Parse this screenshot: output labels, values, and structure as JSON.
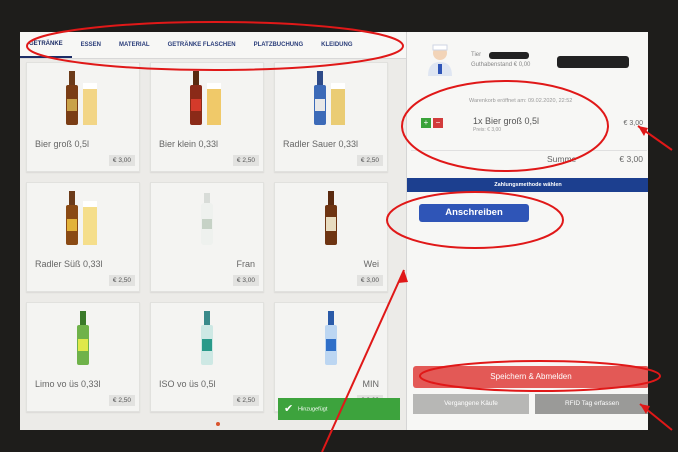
{
  "tabs": [
    {
      "label": "GETRÄNKE",
      "active": true
    },
    {
      "label": "ESSEN"
    },
    {
      "label": "MATERIAL"
    },
    {
      "label": "GETRÄNKE FLASCHEN"
    },
    {
      "label": "PLATZBUCHUNG"
    },
    {
      "label": "KLEIDUNG"
    }
  ],
  "products": [
    {
      "name": "Bier groß 0,5l",
      "price": "€ 3,00"
    },
    {
      "name": "Bier klein 0,33l",
      "price": "€ 2,50"
    },
    {
      "name": "Radler Sauer 0,33l",
      "price": "€ 2,50"
    },
    {
      "name": "Radler Süß 0,33l",
      "price": "€ 2,50"
    },
    {
      "name": "Fran",
      "price": "€ 3,00"
    },
    {
      "name": "Wei",
      "price": "€ 3,00"
    },
    {
      "name": "Limo vo üs 0,33l",
      "price": "€ 2,50"
    },
    {
      "name": "ISO vo üs 0,5l",
      "price": "€ 2,50"
    },
    {
      "name": "MIN",
      "price": "€ 3,00"
    }
  ],
  "user": {
    "line1": "Tier",
    "line2": "Guthabenstand € 0,00"
  },
  "cart": {
    "opened": "Warenkorb eröffnet am: 09.02.2020, 22:52",
    "item_name": "1x Bier groß 0,5l",
    "item_price": "Preis: € 3,00",
    "item_total": "€ 3,00",
    "plus": "+",
    "minus": "−",
    "sum_label": "Summe",
    "sum_value": "€ 3,00"
  },
  "payment": {
    "header": "Zahlungsmethode wählen",
    "anschreiben": "Anschreiben"
  },
  "actions": {
    "save": "Speichern & Abmelden",
    "past": "Vergangene Käufe",
    "rfid": "RFID Tag erfassen"
  },
  "toast": "Hinzugefügt",
  "colors": {
    "accent": "#1c3f8f",
    "button_blue": "#2f55b7",
    "save_red": "#e35956",
    "annotation_red": "#e01818",
    "toast_green": "#3da33d"
  }
}
